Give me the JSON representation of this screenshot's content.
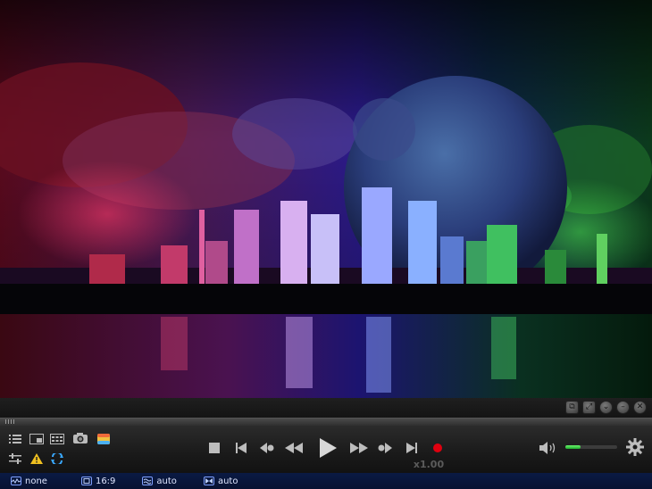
{
  "window": {
    "buttons": [
      "restore-icon",
      "fullscreen-icon",
      "minimize-icon",
      "maximize-icon",
      "close-icon"
    ]
  },
  "controls": {
    "speed_label": "x1.00",
    "volume_level": 0.3,
    "accent_color": "#e0000f",
    "volume_color": "#3fdc3f"
  },
  "status": {
    "audio_label": "none",
    "aspect_label": "16:9",
    "deinterlace_label": "auto",
    "crop_label": "auto"
  }
}
